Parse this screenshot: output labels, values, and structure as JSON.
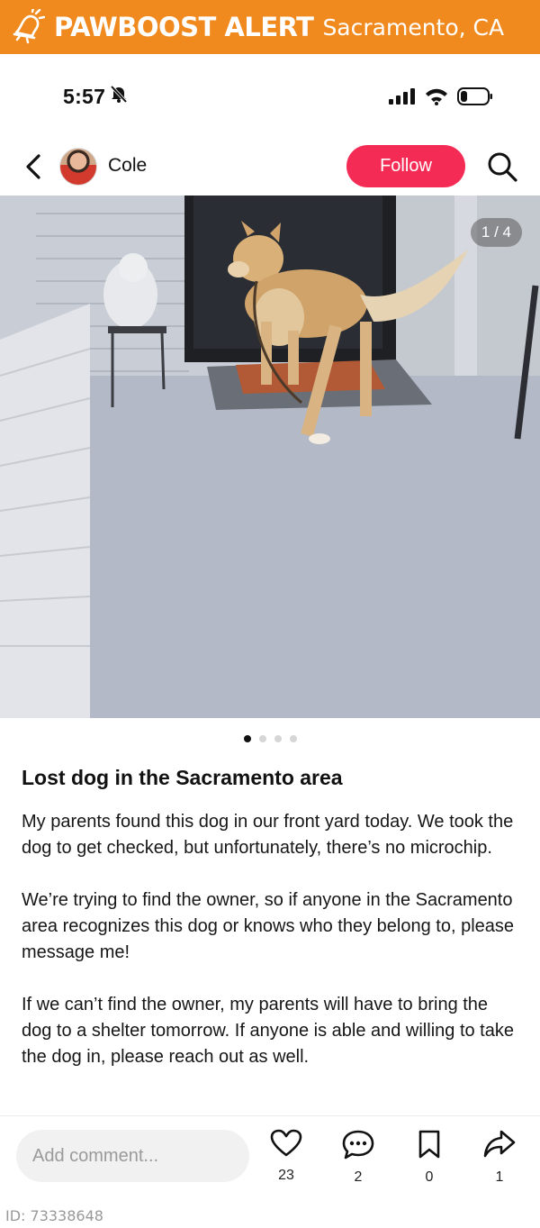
{
  "banner": {
    "brand": "PAWBOOST ALERT",
    "city": "Sacramento, CA",
    "icon": "bell-alert-icon",
    "color": "#f08a1e"
  },
  "status_bar": {
    "time": "5:57",
    "icons": [
      "silent-bell-icon",
      "signal-icon",
      "wifi-icon",
      "battery-icon"
    ]
  },
  "header": {
    "username": "Cole",
    "follow_label": "Follow",
    "follow_color": "#f42c55"
  },
  "photo": {
    "counter": "1 / 4",
    "current": 1,
    "total": 4
  },
  "post": {
    "title": "Lost dog in the Sacramento area",
    "paragraphs": [
      "My parents found this dog in our front yard today. We took the dog to get checked, but unfortunately, there’s no microchip.",
      "We’re trying to find the owner, so if anyone in the Sacramento area recognizes this dog or knows who they belong to, please message me!",
      "If we can’t find the owner, my parents will have to bring the dog to a shelter tomorrow. If anyone is able and willing to take the dog in, please reach out as well."
    ]
  },
  "actions": {
    "comment_placeholder": "Add comment...",
    "likes": "23",
    "comments": "2",
    "saves": "0",
    "shares": "1"
  },
  "footer": {
    "id_text": "ID: 73338648"
  }
}
